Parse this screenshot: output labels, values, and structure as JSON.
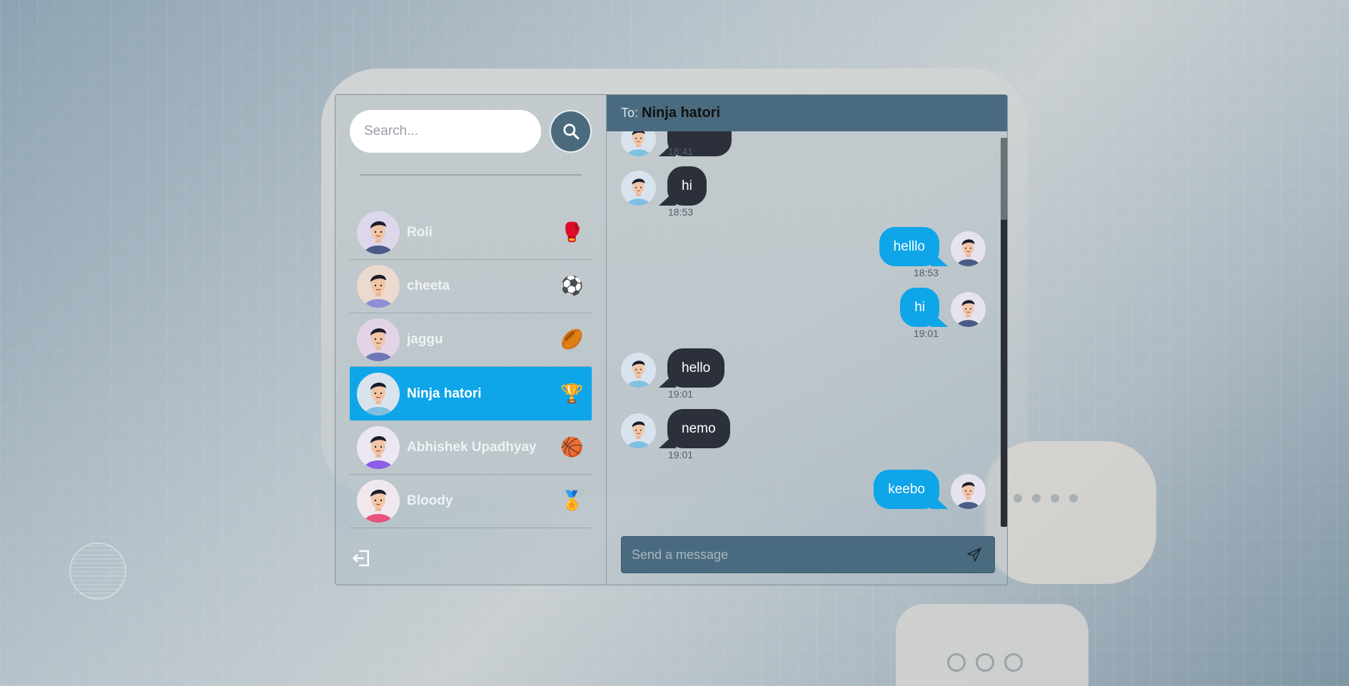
{
  "search": {
    "placeholder": "Search..."
  },
  "conversations": [
    {
      "name": "Roli",
      "emoji": "🥊",
      "emoji_name": "boxing-glove-icon",
      "avatar_bg": "#dcd7ea",
      "shirt": "#4b5a8a",
      "hair": "#1c1c2a",
      "active": false
    },
    {
      "name": "cheeta",
      "emoji": "⚽",
      "emoji_name": "soccer-ball-icon",
      "avatar_bg": "#ecd9cf",
      "shirt": "#8f8ed6",
      "hair": "#1c1c2a",
      "active": false
    },
    {
      "name": "jaggu",
      "emoji": "🏉",
      "emoji_name": "rugby-ball-icon",
      "avatar_bg": "#e2d4e6",
      "shirt": "#6d78b8",
      "hair": "#1c1c2a",
      "active": false
    },
    {
      "name": "Ninja hatori",
      "emoji": "🏆",
      "emoji_name": "trophy-icon",
      "avatar_bg": "#d8e3ee",
      "shirt": "#7fbfe0",
      "hair": "#1c1c2a",
      "active": true
    },
    {
      "name": "Abhishek Upadhyay",
      "emoji": "🏀",
      "emoji_name": "basketball-icon",
      "avatar_bg": "#ece7f3",
      "shirt": "#8d5de8",
      "hair": "#1c1c2a",
      "active": false
    },
    {
      "name": "Bloody",
      "emoji": "🏅",
      "emoji_name": "medal-icon",
      "avatar_bg": "#f0e8ee",
      "shirt": "#e8507e",
      "hair": "#1c1c2a",
      "active": false
    }
  ],
  "chat": {
    "to_label": "To:",
    "to_name": "Ninja hatori",
    "messages": [
      {
        "text": "",
        "time": "18:41",
        "from": "them"
      },
      {
        "text": "hi",
        "time": "18:53",
        "from": "them"
      },
      {
        "text": "helllo",
        "time": "18:53",
        "from": "me"
      },
      {
        "text": "hi",
        "time": "19:01",
        "from": "me"
      },
      {
        "text": "hello",
        "time": "19:01",
        "from": "them"
      },
      {
        "text": "nemo",
        "time": "19:01",
        "from": "them"
      },
      {
        "text": "keebo",
        "time": "",
        "from": "me"
      }
    ]
  },
  "composer": {
    "placeholder": "Send a message"
  },
  "colors": {
    "accent": "#0ea5e9",
    "header": "#4a6b7f",
    "received_bubble": "#2b303b"
  }
}
